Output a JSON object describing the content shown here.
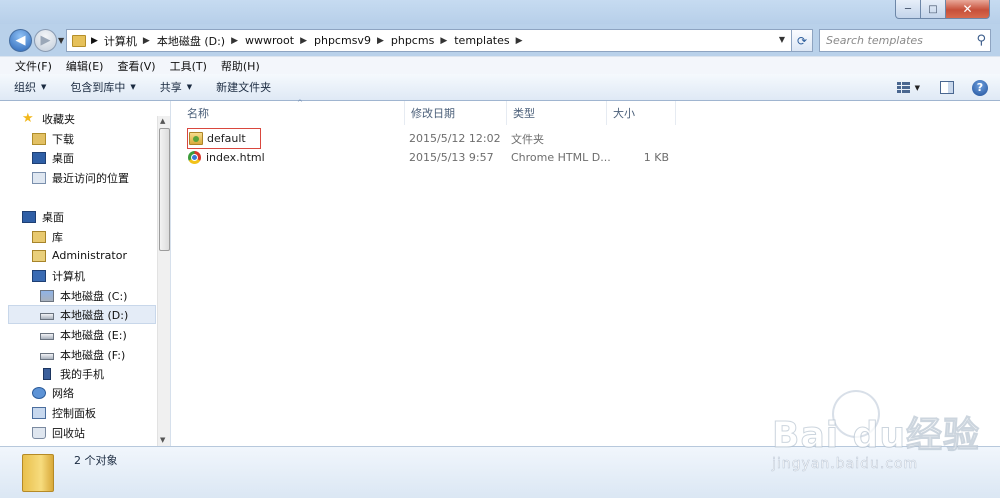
{
  "window": {
    "caption_buttons": {
      "minimize": "─",
      "maximize": "□",
      "close": "✕"
    }
  },
  "navigation": {
    "back_glyph": "◀",
    "forward_glyph": "▶",
    "dropdown_glyph": "▼"
  },
  "address_bar": {
    "crumbs": [
      "计算机",
      "本地磁盘 (D:)",
      "wwwroot",
      "phpcmsv9",
      "phpcms",
      "templates"
    ],
    "separator": "▶",
    "dropdown_glyph": "▼",
    "refresh_glyph": "⟳"
  },
  "search": {
    "placeholder": "Search templates",
    "icon": "search-icon",
    "icon_glyph": "⚲"
  },
  "menu": [
    "文件(F)",
    "编辑(E)",
    "查看(V)",
    "工具(T)",
    "帮助(H)"
  ],
  "commands": {
    "organize": "组织",
    "include_in_library": "包含到库中",
    "share": "共享",
    "new_folder": "新建文件夹",
    "dropdown_glyph": "▼",
    "help_glyph": "?"
  },
  "nav_pane": {
    "favorites": {
      "label": "收藏夹",
      "items": [
        "下载",
        "桌面",
        "最近访问的位置"
      ]
    },
    "desktop": "桌面",
    "libraries": "库",
    "user": "Administrator",
    "computer": {
      "label": "计算机",
      "drives": [
        "本地磁盘 (C:)",
        "本地磁盘 (D:)",
        "本地磁盘 (E:)",
        "本地磁盘 (F:)"
      ]
    },
    "phone": "我的手机",
    "network": "网络",
    "control_panel": "控制面板",
    "recycle_bin": "回收站",
    "selected": "本地磁盘 (D:)",
    "scroll_up_glyph": "▲",
    "scroll_down_glyph": "▼"
  },
  "columns": {
    "name": "名称",
    "date_modified": "修改日期",
    "type": "类型",
    "size": "大小",
    "sort_glyph": "^"
  },
  "files": [
    {
      "name": "default",
      "date_modified": "2015/5/12 12:02",
      "type": "文件夹",
      "size": "",
      "icon": "folder-icon"
    },
    {
      "name": "index.html",
      "date_modified": "2015/5/13 9:57",
      "type": "Chrome HTML D...",
      "size": "1 KB",
      "icon": "chrome-html-icon"
    }
  ],
  "status": {
    "count_text": "2 个对象"
  },
  "watermark": {
    "brand": "Bai du经验",
    "url": "jingyan.baidu.com"
  },
  "colors": {
    "highlight_box": "#d9473e",
    "selected_nav": "#e4ecf7",
    "window_frame": "#b9d1ea"
  }
}
